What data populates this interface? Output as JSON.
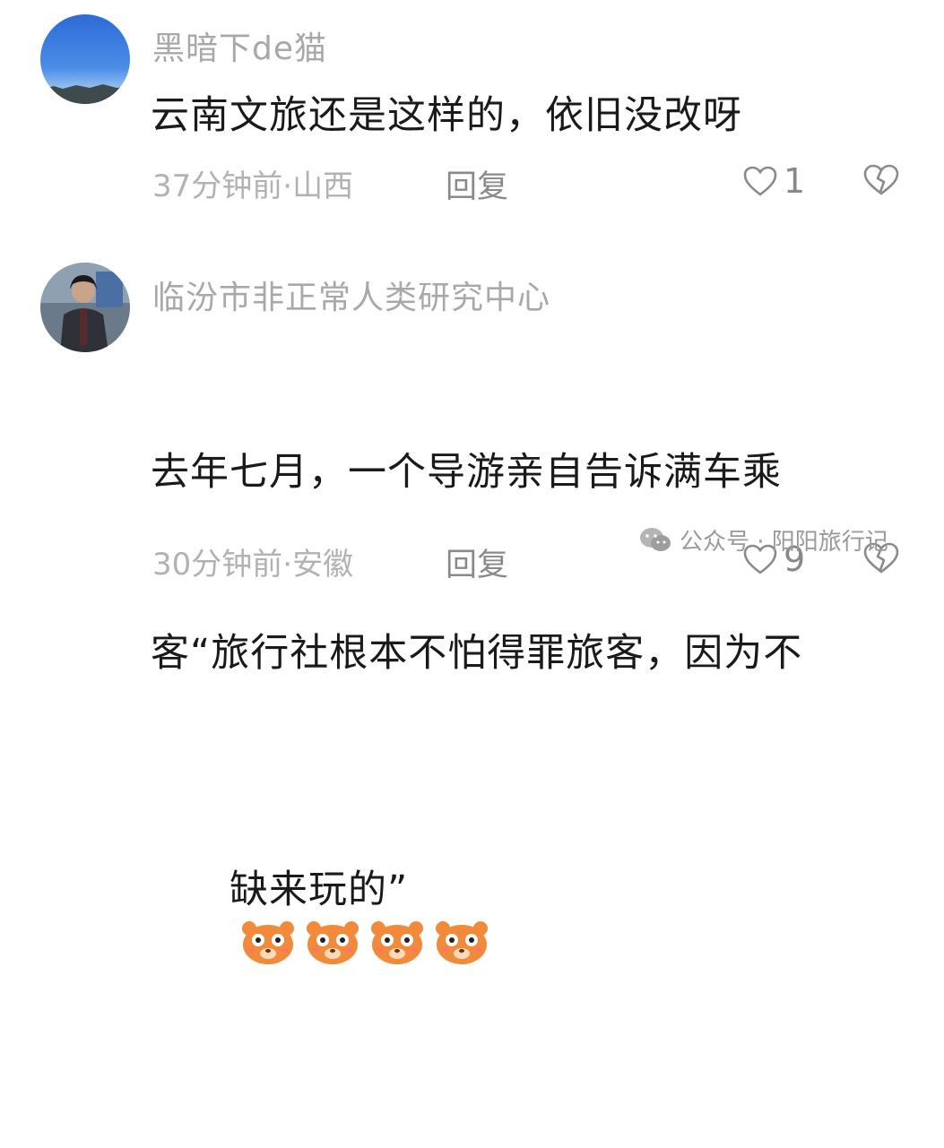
{
  "comments": [
    {
      "username": "黑暗下de猫",
      "text": "云南文旅还是这样的，依旧没改呀",
      "meta": "37分钟前·山西",
      "reply_label": "回复",
      "likes": "1"
    },
    {
      "username": "临汾市非正常人类研究中心",
      "text_lines": [
        "去年七月，一个导游亲自告诉满车乘",
        "客“旅行社根本不怕得罪旅客，因为不",
        "缺来玩的”"
      ],
      "meta": "30分钟前·安徽",
      "reply_label": "回复",
      "likes": "9",
      "emoji_count": 4
    }
  ],
  "watermark": {
    "text": "公众号 · 阳阳旅行记",
    "icon": "wechat-icon"
  },
  "icons": {
    "like": "heart-outline-icon",
    "dislike": "broken-heart-icon",
    "emoji": "bear-face-emoji"
  },
  "colors": {
    "username": "#a8a8a8",
    "body": "#1a1a1a",
    "meta": "#b2b2b2",
    "emoji": "#f28a3c"
  }
}
